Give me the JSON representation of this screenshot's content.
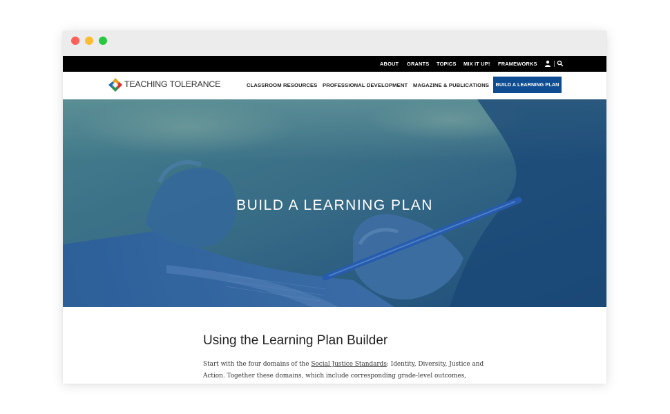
{
  "utility_nav": {
    "items": [
      "ABOUT",
      "GRANTS",
      "TOPICS",
      "MIX IT UP!",
      "FRAMEWORKS"
    ],
    "icons": [
      "user-icon",
      "search-icon"
    ]
  },
  "brand": {
    "name": "TEACHING TOLERANCE"
  },
  "main_nav": {
    "items": [
      "CLASSROOM RESOURCES",
      "PROFESSIONAL DEVELOPMENT",
      "MAGAZINE & PUBLICATIONS"
    ],
    "cta": "BUILD A LEARNING PLAN"
  },
  "hero": {
    "title": "BUILD A LEARNING PLAN"
  },
  "section": {
    "title": "Using the Learning Plan Builder",
    "line1_before": "Start with the four domains of the ",
    "line1_link": "Social Justice Standards",
    "line1_after": ": Identity, Diversity, Justice and",
    "line2": "Action. Together these domains, which include corresponding grade-level outcomes,"
  },
  "colors": {
    "cta_background": "#0e4d92",
    "utility_bar": "#000000",
    "hero_overlay": "#2d5f87"
  }
}
